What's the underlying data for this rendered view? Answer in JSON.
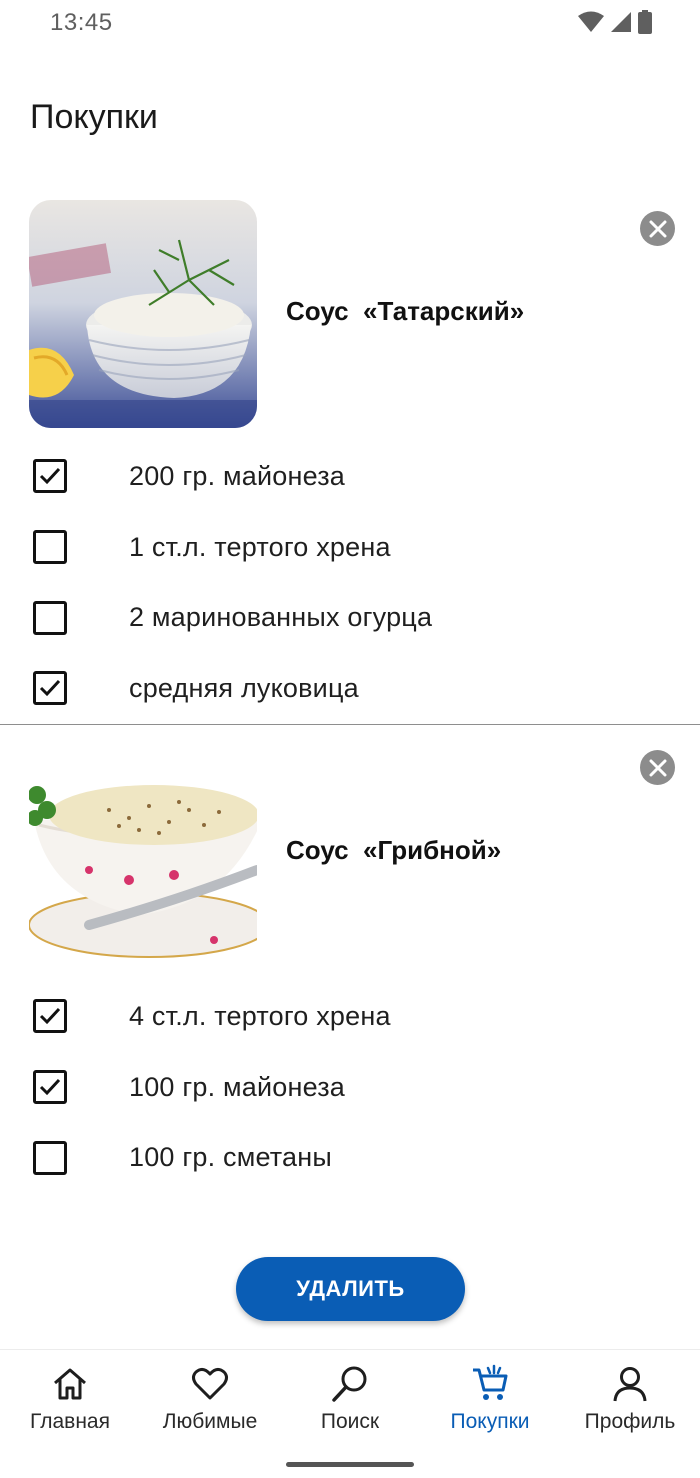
{
  "status_bar": {
    "time": "13:45"
  },
  "page": {
    "title": "Покупки"
  },
  "recipes": [
    {
      "title": "Соус  «Татарский»",
      "ingredients": [
        {
          "label": "200 гр. майонеза",
          "checked": true
        },
        {
          "label": "1 ст.л. тертого хрена",
          "checked": false
        },
        {
          "label": "2 маринованных огурца",
          "checked": false
        },
        {
          "label": "средняя луковица",
          "checked": true
        }
      ]
    },
    {
      "title": "Соус  «Грибной»",
      "ingredients": [
        {
          "label": "4 ст.л. тертого хрена",
          "checked": true
        },
        {
          "label": "100 гр. майонеза",
          "checked": true
        },
        {
          "label": "100 гр. сметаны",
          "checked": false
        }
      ]
    }
  ],
  "actions": {
    "delete_label": "УДАЛИТЬ"
  },
  "nav": {
    "items": [
      {
        "label": "Главная",
        "icon": "home-icon",
        "active": false
      },
      {
        "label": "Любимые",
        "icon": "heart-icon",
        "active": false
      },
      {
        "label": "Поиск",
        "icon": "search-icon",
        "active": false
      },
      {
        "label": "Покупки",
        "icon": "cart-icon",
        "active": true
      },
      {
        "label": "Профиль",
        "icon": "profile-icon",
        "active": false
      }
    ]
  },
  "colors": {
    "accent": "#0a5db5",
    "remove_button": "#8c8c8c"
  }
}
